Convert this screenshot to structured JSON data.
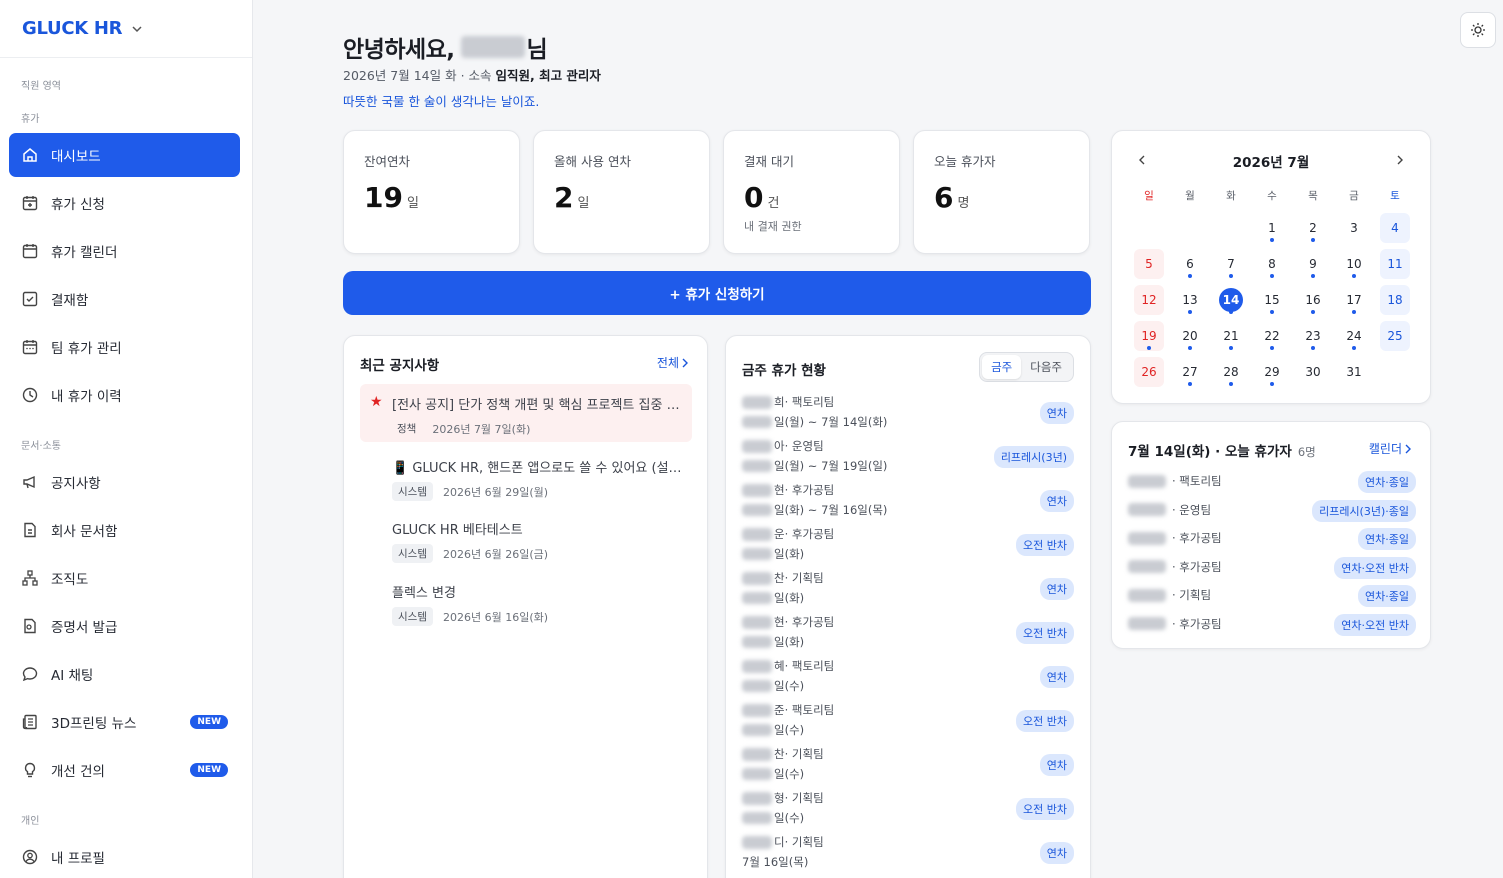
{
  "app": {
    "brand": "GLUCK HR"
  },
  "sidebar": {
    "section_staff": "직원 영역",
    "section_leave": "휴가",
    "section_docs": "문서·소통",
    "section_personal": "개인",
    "items": [
      {
        "label": "대시보드",
        "icon": "home-icon"
      },
      {
        "label": "휴가 신청",
        "icon": "calendar-plus-icon"
      },
      {
        "label": "휴가 캘린더",
        "icon": "calendar-icon"
      },
      {
        "label": "결재함",
        "icon": "checkbox-icon"
      },
      {
        "label": "팀 휴가 관리",
        "icon": "calendar-team-icon"
      },
      {
        "label": "내 휴가 이력",
        "icon": "clock-icon"
      },
      {
        "label": "공지사항",
        "icon": "megaphone-icon"
      },
      {
        "label": "회사 문서함",
        "icon": "document-icon"
      },
      {
        "label": "조직도",
        "icon": "org-chart-icon"
      },
      {
        "label": "증명서 발급",
        "icon": "certificate-icon"
      },
      {
        "label": "AI 채팅",
        "icon": "chat-icon"
      },
      {
        "label": "3D프린팅 뉴스",
        "icon": "newspaper-icon",
        "badge": "NEW"
      },
      {
        "label": "개선 건의",
        "icon": "lightbulb-icon",
        "badge": "NEW"
      },
      {
        "label": "내 프로필",
        "icon": "profile-icon"
      }
    ]
  },
  "header": {
    "greeting": "안녕하세요,",
    "honorific": "님",
    "date_line": "2026년 7월 14일 화 · 소속 ",
    "role_bold": "임직원, 최고 관리자",
    "quote": "따뜻한 국물 한 술이 생각나는 날이죠."
  },
  "stats": [
    {
      "label": "잔여연차",
      "value": "19",
      "unit": "일",
      "note": ""
    },
    {
      "label": "올해 사용 연차",
      "value": "2",
      "unit": "일",
      "note": ""
    },
    {
      "label": "결재 대기",
      "value": "0",
      "unit": "건",
      "note": "내 결재 권한"
    },
    {
      "label": "오늘 휴가자",
      "value": "6",
      "unit": "명",
      "note": ""
    }
  ],
  "apply_button": "+ 휴가 신청하기",
  "notices": {
    "title": "최근 공지사항",
    "all_link": "전체",
    "items": [
      {
        "title": "[전사 공지] 단가 정책 개편 및 핵심 프로젝트 집중 …",
        "tag": "정책",
        "date": "2026년 7월 7일(화)",
        "starred": true
      },
      {
        "title": "📱 GLUCK HR, 핸드폰 앱으로도 쓸 수 있어요 (설…",
        "tag": "시스템",
        "date": "2026년 6월 29일(월)",
        "starred": false
      },
      {
        "title": "GLUCK HR 베타테스트",
        "tag": "시스템",
        "date": "2026년 6월 26일(금)",
        "starred": false
      },
      {
        "title": "플렉스 변경",
        "tag": "시스템",
        "date": "2026년 6월 16일(화)",
        "starred": false
      }
    ]
  },
  "week": {
    "title": "금주 휴가 현황",
    "tabs": [
      "금주",
      "다음주"
    ],
    "rows": [
      {
        "name_tail": "희",
        "team": " · 팩토리팀",
        "dates": "일(월) ~ 7월 14일(화)",
        "type": "연차"
      },
      {
        "name_tail": "아",
        "team": " · 운영팀",
        "dates": "일(월) ~ 7월 19일(일)",
        "type": "리프레시(3년)"
      },
      {
        "name_tail": "현",
        "team": " · 후가공팀",
        "dates": "일(화) ~ 7월 16일(목)",
        "type": "연차"
      },
      {
        "name_tail": "운",
        "team": " · 후가공팀",
        "dates": "일(화)",
        "type": "오전 반차"
      },
      {
        "name_tail": "찬",
        "team": " · 기획팀",
        "dates": "일(화)",
        "type": "연차"
      },
      {
        "name_tail": "현",
        "team": " · 후가공팀",
        "dates": "일(화)",
        "type": "오전 반차"
      },
      {
        "name_tail": "혜",
        "team": " · 팩토리팀",
        "dates": "일(수)",
        "type": "연차"
      },
      {
        "name_tail": "준",
        "team": " · 팩토리팀",
        "dates": "일(수)",
        "type": "오전 반차"
      },
      {
        "name_tail": "찬",
        "team": " · 기획팀",
        "dates": "일(수)",
        "type": "연차"
      },
      {
        "name_tail": "형",
        "team": " · 기획팀",
        "dates": "일(수)",
        "type": "오전 반차"
      },
      {
        "name_tail": "디",
        "team": " · 기획팀",
        "dates": "7월 16일(목)",
        "type": "연차"
      }
    ]
  },
  "calendar": {
    "title": "2026년 7월",
    "weekdays": [
      "일",
      "월",
      "화",
      "수",
      "목",
      "금",
      "토"
    ],
    "today": 14
  },
  "today_off": {
    "title": "7월 14일(화) · 오늘 휴가자",
    "count": "6명",
    "link": "캘린더",
    "rows": [
      {
        "team": "· 팩토리팀",
        "type": "연차·종일"
      },
      {
        "team": "· 운영팀",
        "type": "리프레시(3년)·종일"
      },
      {
        "team": "· 후가공팀",
        "type": "연차·종일"
      },
      {
        "team": "· 후가공팀",
        "type": "연차·오전 반차"
      },
      {
        "team": "· 기획팀",
        "type": "연차·종일"
      },
      {
        "team": "· 후가공팀",
        "type": "연차·오전 반차"
      }
    ]
  },
  "colors": {
    "accent": "#1f5bea",
    "sunday": "#e02424"
  }
}
